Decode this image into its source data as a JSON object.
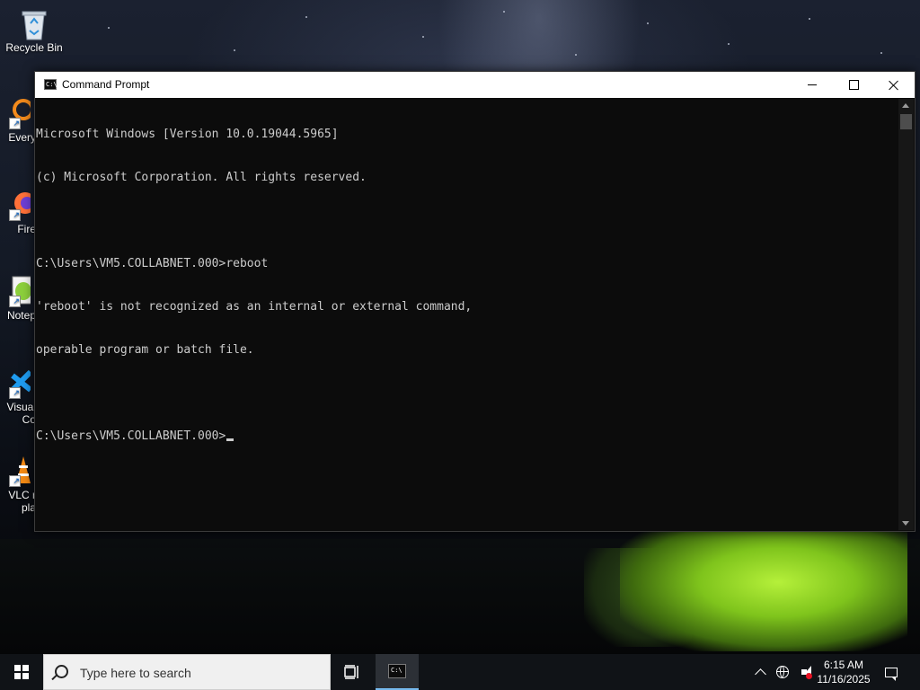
{
  "desktop": {
    "icons": [
      {
        "label": "Recycle Bin",
        "icon": "recycle-bin-icon"
      },
      {
        "label": "Every",
        "icon": "everything-search-icon"
      },
      {
        "label": "Fire",
        "icon": "firefox-icon"
      },
      {
        "label": "Notep",
        "icon": "notepad-plus-plus-icon"
      },
      {
        "label": "Visual",
        "label2": "Co",
        "icon": "visual-studio-code-icon"
      },
      {
        "label": "VLC r",
        "label2": "pla",
        "icon": "vlc-player-icon"
      }
    ]
  },
  "window": {
    "title": "Command Prompt",
    "console_lines": [
      "Microsoft Windows [Version 10.0.19044.5965]",
      "(c) Microsoft Corporation. All rights reserved.",
      "",
      "C:\\Users\\VM5.COLLABNET.000>reboot",
      "'reboot' is not recognized as an internal or external command,",
      "operable program or batch file.",
      "",
      "C:\\Users\\VM5.COLLABNET.000>"
    ]
  },
  "taskbar": {
    "search_placeholder": "Type here to search",
    "clock": {
      "time": "6:15 AM",
      "date": "11/16/2025"
    }
  },
  "colors": {
    "console_bg": "#0c0c0c",
    "console_fg": "#cccccc",
    "taskbar_bg": "#101317",
    "active_underline": "#76b9ed"
  }
}
